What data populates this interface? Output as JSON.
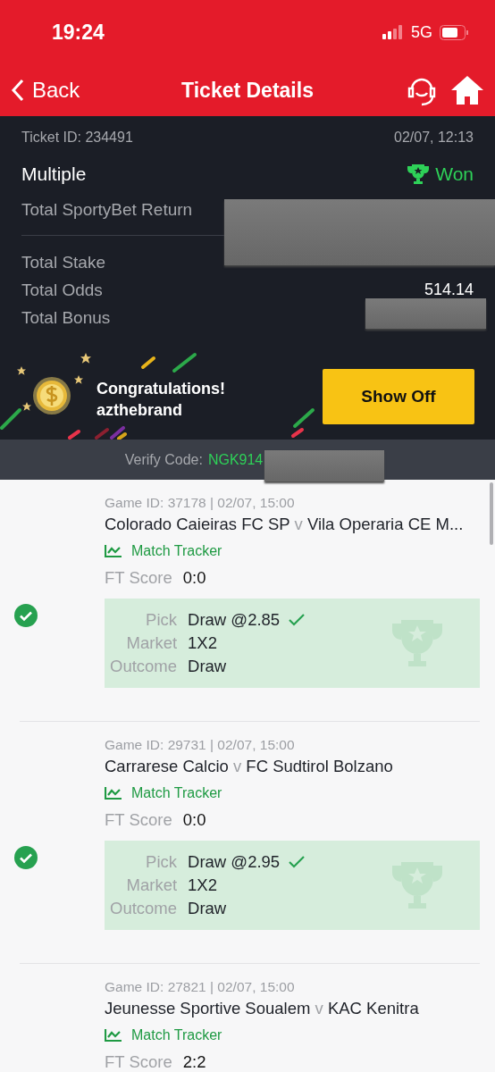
{
  "status_bar": {
    "time": "19:24",
    "network": "5G"
  },
  "nav": {
    "back": "Back",
    "title": "Ticket Details"
  },
  "ticket": {
    "id_label": "Ticket ID: 234491",
    "datetime": "02/07, 12:13",
    "type": "Multiple",
    "status": "Won",
    "return_label": "Total SportyBet Return",
    "stake_label": "Total Stake",
    "odds_label": "Total Odds",
    "odds_value": "514.14",
    "bonus_label": "Total Bonus"
  },
  "promo": {
    "line1": "Congratulations!",
    "line2": "azthebrand",
    "button": "Show Off"
  },
  "verify": {
    "label": "Verify Code:",
    "code": "NGK914"
  },
  "games": [
    {
      "meta": "Game ID: 37178 | 02/07, 15:00",
      "home": "Colorado Caieiras FC SP",
      "vs": "v",
      "away": "Vila Operaria CE M...",
      "tracker": "Match Tracker",
      "score_label": "FT Score",
      "score": "0:0",
      "won": true,
      "pick": {
        "pick_label": "Pick",
        "pick": "Draw @2.85",
        "market_label": "Market",
        "market": "1X2",
        "outcome_label": "Outcome",
        "outcome": "Draw"
      }
    },
    {
      "meta": "Game ID: 29731 | 02/07, 15:00",
      "home": "Carrarese Calcio",
      "vs": "v",
      "away": "FC Sudtirol Bolzano",
      "tracker": "Match Tracker",
      "score_label": "FT Score",
      "score": "0:0",
      "won": true,
      "pick": {
        "pick_label": "Pick",
        "pick": "Draw @2.95",
        "market_label": "Market",
        "market": "1X2",
        "outcome_label": "Outcome",
        "outcome": "Draw"
      }
    },
    {
      "meta": "Game ID: 27821 | 02/07, 15:00",
      "home": "Jeunesse Sportive Soualem",
      "vs": "v",
      "away": "KAC Kenitra",
      "tracker": "Match Tracker",
      "score_label": "FT Score",
      "score": "2:2"
    }
  ]
}
